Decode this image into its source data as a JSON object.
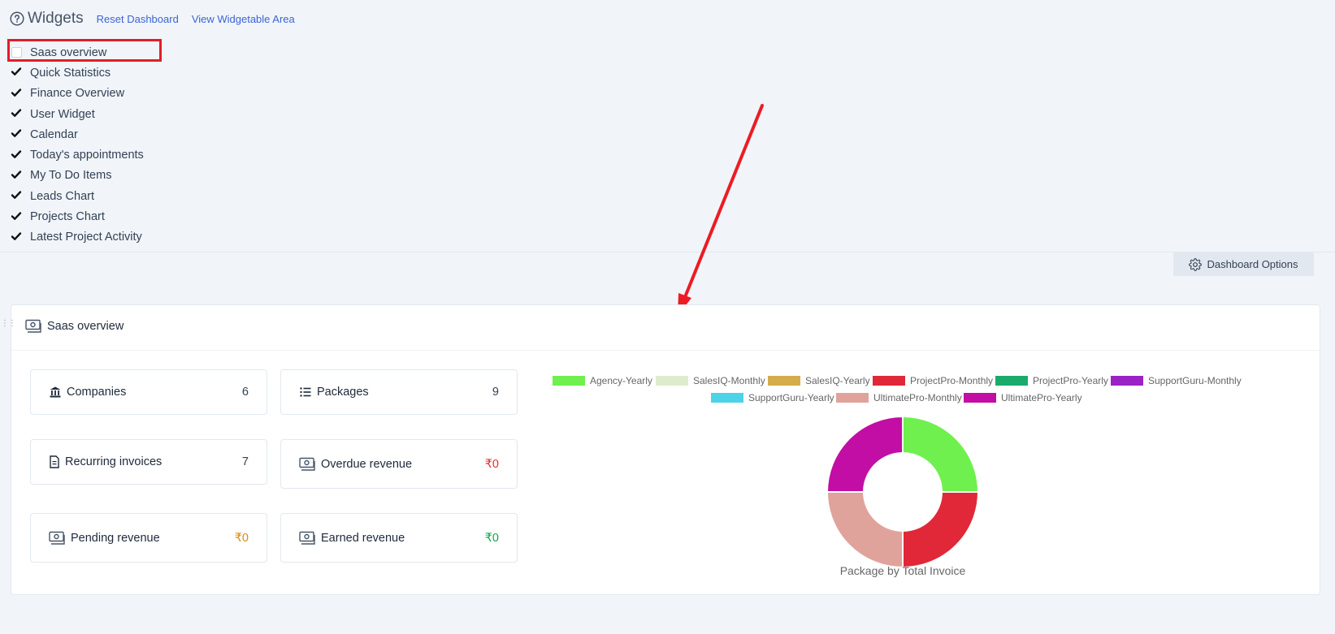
{
  "header": {
    "title": "Widgets",
    "reset_link": "Reset Dashboard",
    "view_link": "View Widgetable Area"
  },
  "widgets": [
    {
      "label": "Saas overview",
      "checked": false
    },
    {
      "label": "Quick Statistics",
      "checked": true
    },
    {
      "label": "Finance Overview",
      "checked": true
    },
    {
      "label": "User Widget",
      "checked": true
    },
    {
      "label": "Calendar",
      "checked": true
    },
    {
      "label": "Today's appointments",
      "checked": true
    },
    {
      "label": "My To Do Items",
      "checked": true
    },
    {
      "label": "Leads Chart",
      "checked": true
    },
    {
      "label": "Projects Chart",
      "checked": true
    },
    {
      "label": "Latest Project Activity",
      "checked": true
    }
  ],
  "dashboard_options": "Dashboard Options",
  "panel": {
    "title": "Saas overview",
    "cards": [
      {
        "label": "Companies",
        "value": "6",
        "icon": "bank-icon"
      },
      {
        "label": "Packages",
        "value": "9",
        "icon": "list-icon"
      },
      {
        "label": "Recurring invoices",
        "value": "7",
        "icon": "document-icon"
      },
      {
        "label": "Overdue revenue",
        "value": "₹0",
        "icon": "money-icon",
        "value_color": "#ef2b2b"
      },
      {
        "label": "Pending revenue",
        "value": "₹0",
        "icon": "money-icon",
        "value_color": "#d98a12"
      },
      {
        "label": "Earned revenue",
        "value": "₹0",
        "icon": "money-icon",
        "value_color": "#16a34a"
      }
    ]
  },
  "chart_data": {
    "type": "pie",
    "title": "Package by Total Invoice",
    "donut": true,
    "legend_position": "top",
    "series": [
      {
        "name": "Agency-Yearly",
        "value": 1,
        "color": "#6ff04e"
      },
      {
        "name": "SalesIQ-Monthly",
        "value": 0,
        "color": "#ddeccd"
      },
      {
        "name": "SalesIQ-Yearly",
        "value": 0,
        "color": "#d4ad4a"
      },
      {
        "name": "ProjectPro-Monthly",
        "value": 1,
        "color": "#e02838"
      },
      {
        "name": "ProjectPro-Yearly",
        "value": 0,
        "color": "#1aab6c"
      },
      {
        "name": "SupportGuru-Monthly",
        "value": 0,
        "color": "#9b22c4"
      },
      {
        "name": "SupportGuru-Yearly",
        "value": 0,
        "color": "#4dd3e8"
      },
      {
        "name": "UltimatePro-Monthly",
        "value": 1,
        "color": "#e0a39c"
      },
      {
        "name": "UltimatePro-Yearly",
        "value": 1,
        "color": "#c20ea4"
      }
    ]
  }
}
